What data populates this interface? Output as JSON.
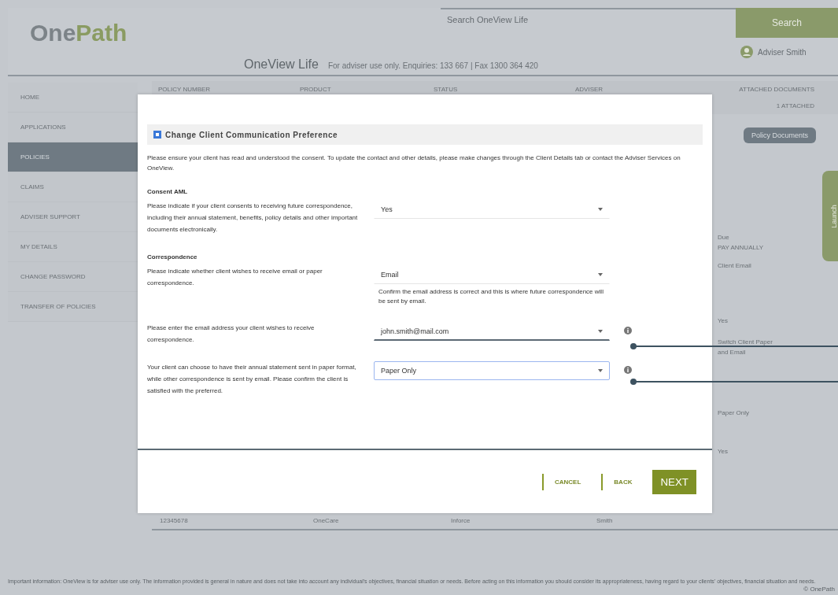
{
  "header": {
    "logo": "OnePath",
    "search": {
      "placeholder": "Search OneView Life"
    },
    "search_button": "Search",
    "user": "Adviser Smith",
    "title": "OneView Life",
    "subtitle": "For adviser use only. Enquiries: 133 667 | Fax 1300 364 420"
  },
  "sidebar": {
    "items": [
      {
        "label": "HOME",
        "selected": false
      },
      {
        "label": "APPLICATIONS",
        "selected": false
      },
      {
        "label": "POLICIES",
        "selected": true
      },
      {
        "label": "CLAIMS",
        "selected": false
      },
      {
        "label": "ADVISER SUPPORT",
        "selected": false
      },
      {
        "label": "MY DETAILS",
        "selected": false
      },
      {
        "label": "CHANGE PASSWORD",
        "selected": false
      },
      {
        "label": "TRANSFER OF POLICIES",
        "selected": false
      }
    ]
  },
  "table": {
    "columns": [
      "POLICY NUMBER",
      "PRODUCT",
      "STATUS",
      "ADVISER",
      "ATTACHED DOCUMENTS"
    ],
    "top_right": "1 ATTACHED",
    "bottom_row": [
      "12345678",
      "OneCare",
      "Inforce",
      "Smith"
    ]
  },
  "right_panel": {
    "button": "Policy Documents",
    "launch": "Launch",
    "texts": [
      "Due",
      "PAY ANNUALLY",
      "Client Email",
      "Yes",
      "Switch Client Paper",
      "and Email",
      "Paper Only",
      "Yes"
    ]
  },
  "modal": {
    "title": "Change Client Communication Preference",
    "intro": "Please ensure your client has read and understood the consent. To update the contact and other details, please make changes through the Client Details tab or contact the Adviser Services on OneView.",
    "rows": [
      {
        "heading": "Consent AML",
        "text": "Please indicate if your client consents to receiving future correspondence, including their annual statement, benefits, policy details and other important documents electronically.",
        "value": "Yes",
        "focused": false
      },
      {
        "heading": "Correspondence",
        "text": "Please indicate whether client wishes to receive email or paper correspondence.",
        "value": "Email",
        "note": "Confirm the email address is correct and this is where future correspondence will be sent by email.",
        "focused": false
      },
      {
        "text": "Please enter the email address your client wishes to receive correspondence.",
        "value": "john.smith@mail.com",
        "focused": false
      },
      {
        "text": "Your client can choose to have their annual statement sent in paper format, while other correspondence is sent by email. Please confirm the client is satisfied with the preferred.",
        "value": "Paper Only",
        "focused": true
      }
    ],
    "buttons": [
      "CANCEL",
      "BACK",
      "NEXT"
    ]
  },
  "footer": {
    "text": "Important information: OneView is for adviser use only. The information provided is general in nature and does not take into account any individual's objectives, financial situation or needs. Before acting on this information you should consider its appropriateness, having regard to your clients' objectives, financial situation and needs.",
    "copyright": "© OnePath"
  }
}
